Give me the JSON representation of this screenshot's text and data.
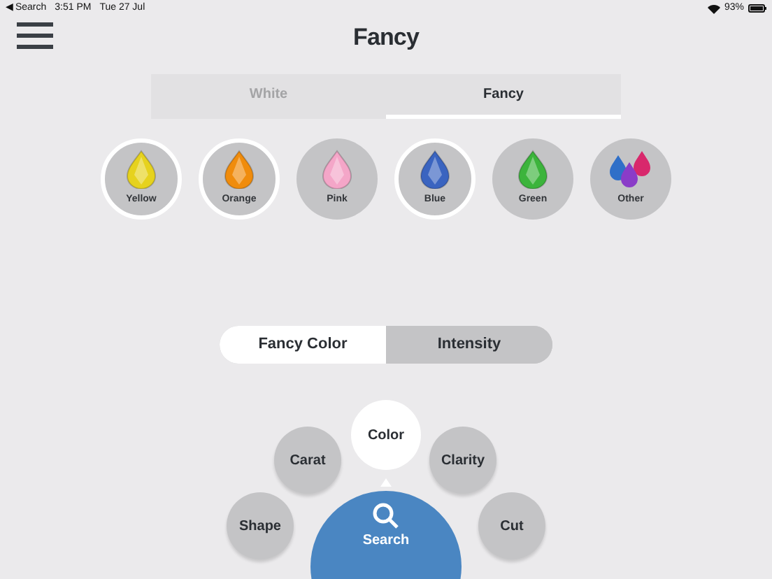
{
  "status_bar": {
    "back": "◀ Search",
    "time": "3:51 PM",
    "date": "Tue 27 Jul",
    "battery": "93%"
  },
  "title": "Fancy",
  "tabs": [
    {
      "label": "White",
      "selected": false
    },
    {
      "label": "Fancy",
      "selected": true
    }
  ],
  "colors": [
    {
      "label": "Yellow",
      "kind": "gem",
      "color": "#e6d21e",
      "selected": true
    },
    {
      "label": "Orange",
      "kind": "gem",
      "color": "#f08c0c",
      "selected": true
    },
    {
      "label": "Pink",
      "kind": "gem",
      "color": "#f4a6c8",
      "selected": false
    },
    {
      "label": "Blue",
      "kind": "gem",
      "color": "#3a64c0",
      "selected": true
    },
    {
      "label": "Green",
      "kind": "gem",
      "color": "#3cb43c",
      "selected": false
    },
    {
      "label": "Other",
      "kind": "mixed",
      "selected": false
    }
  ],
  "segments": [
    {
      "label": "Fancy Color",
      "selected": true
    },
    {
      "label": "Intensity",
      "selected": false
    }
  ],
  "menu": {
    "items": [
      {
        "label": "Shape",
        "selected": false
      },
      {
        "label": "Carat",
        "selected": false
      },
      {
        "label": "Color",
        "selected": true
      },
      {
        "label": "Clarity",
        "selected": false
      },
      {
        "label": "Cut",
        "selected": false
      }
    ],
    "search": "Search"
  }
}
